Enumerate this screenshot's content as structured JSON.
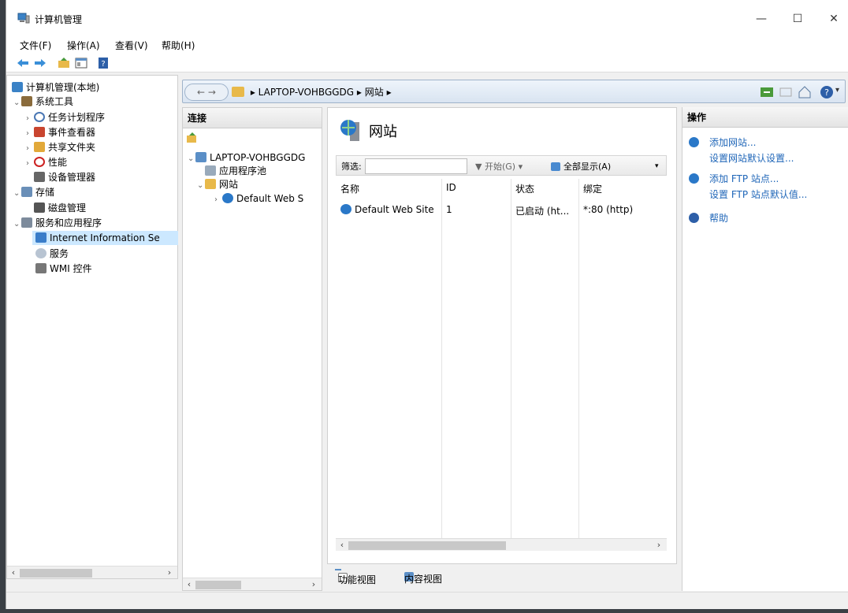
{
  "window": {
    "title": "计算机管理",
    "minimize": "—",
    "maximize": "☐",
    "close": "✕"
  },
  "menu": [
    "文件(F)",
    "操作(A)",
    "查看(V)",
    "帮助(H)"
  ],
  "tree": {
    "root": "计算机管理(本地)",
    "system_tools": "系统工具",
    "task_scheduler": "任务计划程序",
    "event_viewer": "事件查看器",
    "shared_folders": "共享文件夹",
    "performance": "性能",
    "device_manager": "设备管理器",
    "storage": "存储",
    "disk_management": "磁盘管理",
    "services_apps": "服务和应用程序",
    "iis": "Internet Information Se",
    "services": "服务",
    "wmi": "WMI 控件"
  },
  "address": {
    "crumbs": [
      "LAPTOP-VOHBGGDG",
      "网站"
    ]
  },
  "connections": {
    "title": "连接",
    "server": "LAPTOP-VOHBGGDG",
    "app_pools": "应用程序池",
    "sites": "网站",
    "default_site": "Default Web S"
  },
  "main": {
    "title": "网站",
    "filter_label": "筛选:",
    "start_label": "开始(G)",
    "show_all_label": "全部显示(A)",
    "columns": [
      "名称",
      "ID",
      "状态",
      "绑定"
    ],
    "rows": [
      {
        "name": "Default Web Site",
        "id": "1",
        "status": "已启动 (ht...",
        "binding": "*:80 (http)"
      }
    ],
    "tab_features": "功能视图",
    "tab_content": "内容视图"
  },
  "actions": {
    "title": "操作",
    "add_site": "添加网站...",
    "site_defaults": "设置网站默认设置...",
    "add_ftp": "添加 FTP 站点...",
    "ftp_defaults": "设置 FTP 站点默认值...",
    "help": "帮助"
  },
  "colors": {
    "link": "#1f66b8",
    "selection": "#cce8ff",
    "accent": "#2a78c8"
  }
}
